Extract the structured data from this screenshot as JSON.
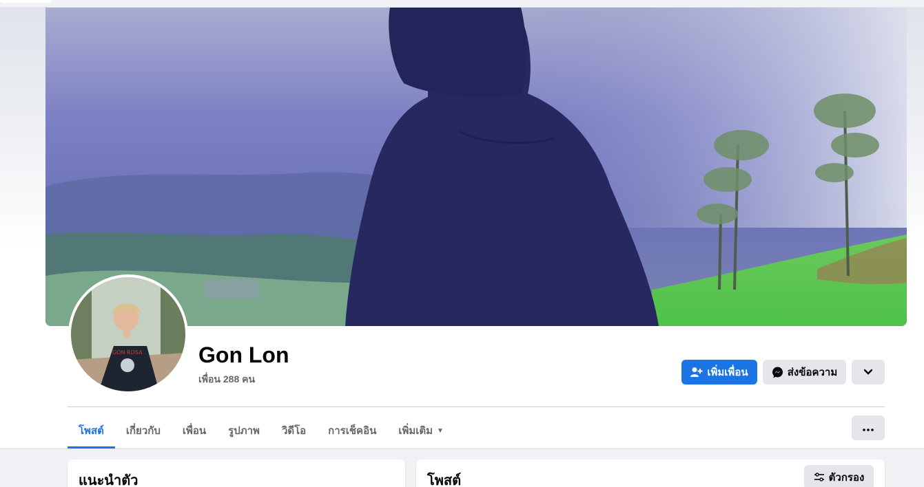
{
  "profile": {
    "name": "Gon Lon",
    "friend_count": "เพื่อน 288 คน"
  },
  "actions": {
    "add_friend": "เพิ่มเพื่อน",
    "message": "ส่งข้อความ"
  },
  "tabs": [
    {
      "label": "โพสต์",
      "active": true
    },
    {
      "label": "เกี่ยวกับ"
    },
    {
      "label": "เพื่อน"
    },
    {
      "label": "รูปภาพ"
    },
    {
      "label": "วิดีโอ"
    },
    {
      "label": "การเช็คอิน"
    },
    {
      "label": "เพิ่มเติม"
    }
  ],
  "sections": {
    "intro_title": "แนะนำตัว",
    "posts_title": "โพสต์",
    "filter_label": "ตัวกรอง"
  },
  "colors": {
    "primary": "#1b74e4",
    "secondary_button": "#e4e6eb",
    "muted_text": "#65676b"
  },
  "icons": [
    "add-friend-icon",
    "messenger-icon",
    "chevron-down-icon",
    "more-dots-icon",
    "filter-icon",
    "caret-down-icon"
  ]
}
